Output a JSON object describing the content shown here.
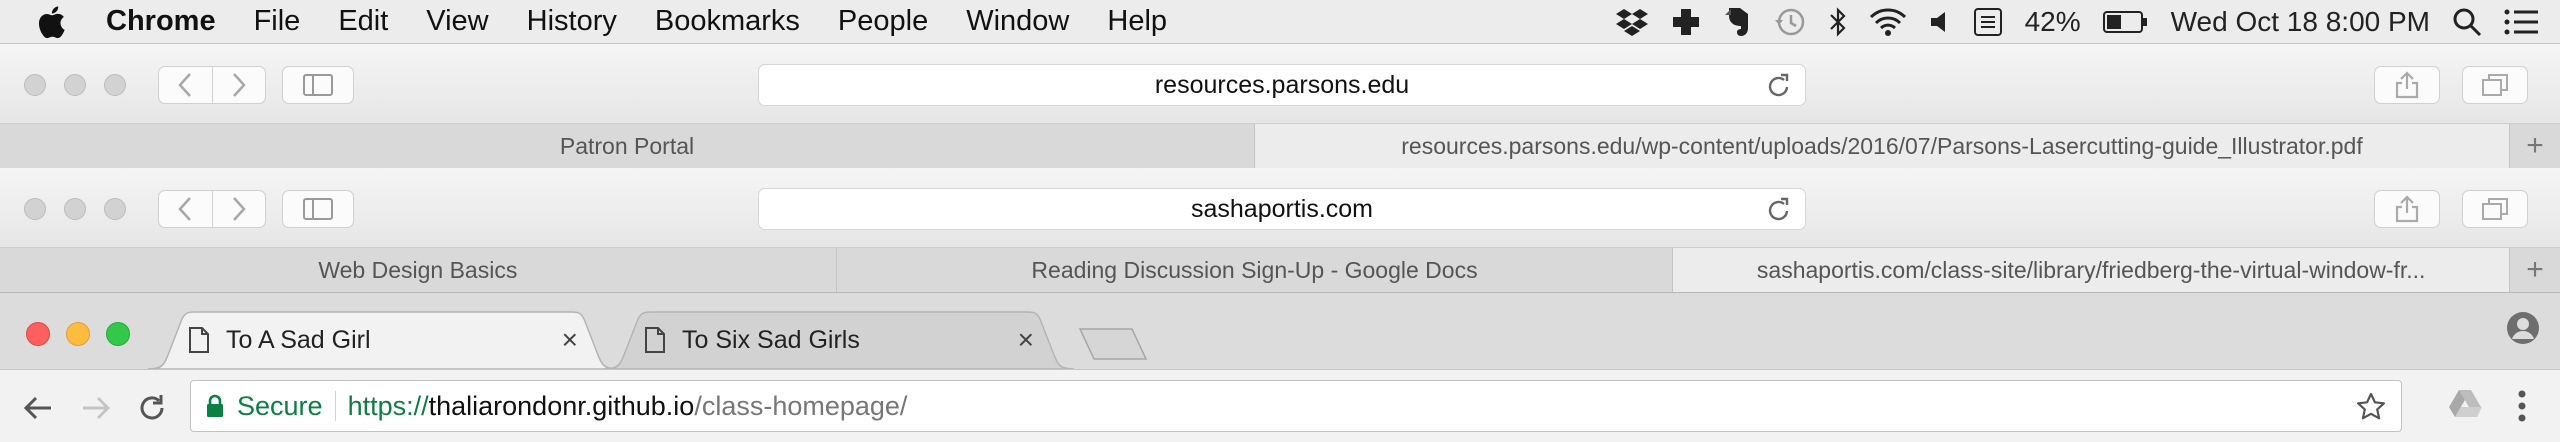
{
  "menubar": {
    "app_name": "Chrome",
    "items": [
      "File",
      "Edit",
      "View",
      "History",
      "Bookmarks",
      "People",
      "Window",
      "Help"
    ],
    "battery": "42%",
    "datetime": "Wed Oct 18  8:00 PM",
    "status_icons": [
      "dropbox-icon",
      "plus-cross-icon",
      "evernote-icon",
      "time-machine-icon",
      "bluetooth-icon",
      "wifi-icon",
      "volume-icon",
      "keyboard-input-icon",
      "battery-icon",
      "spotlight-icon",
      "notification-center-icon"
    ]
  },
  "safari_1": {
    "address": "resources.parsons.edu",
    "tabs": [
      {
        "label": "Patron Portal",
        "active": false
      },
      {
        "label": "resources.parsons.edu/wp-content/uploads/2016/07/Parsons-Lasercutting-guide_Illustrator.pdf",
        "active": true
      }
    ],
    "new_tab": "+"
  },
  "safari_2": {
    "address": "sashaportis.com",
    "tabs": [
      {
        "label": "Web Design Basics",
        "active": false
      },
      {
        "label": "Reading Discussion Sign-Up - Google Docs",
        "active": false
      },
      {
        "label": "sashaportis.com/class-site/library/friedberg-the-virtual-window-fr...",
        "active": true
      }
    ],
    "new_tab": "+"
  },
  "chrome": {
    "tabs": [
      {
        "label": "To A Sad Girl",
        "close": "×",
        "active": true
      },
      {
        "label": "To Six Sad Girls",
        "close": "×",
        "active": false
      }
    ],
    "omnibox": {
      "secure_label": "Secure",
      "scheme": "https://",
      "host": "thaliarondonr.github.io",
      "path": "/class-homepage/"
    }
  },
  "colors": {
    "secure_green": "#0b8043",
    "traffic_red": "#fc605c",
    "traffic_yellow": "#fdbc40",
    "traffic_green": "#34c84a"
  }
}
